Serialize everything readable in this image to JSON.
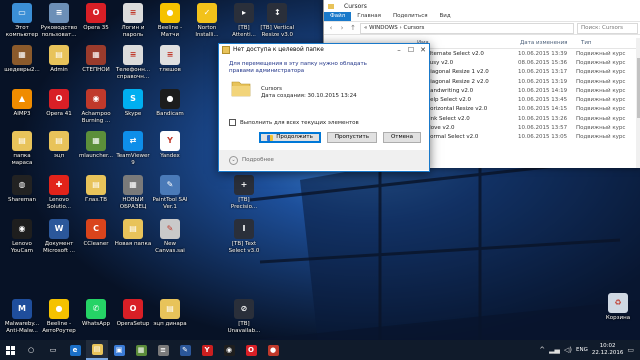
{
  "desktop": {
    "icons": [
      {
        "label": "Этот\nкомпьютер",
        "icon": "computer-icon",
        "color": "#3b8fd6",
        "glyph": "▭"
      },
      {
        "label": "Руководство\nпользоват...",
        "icon": "document-icon",
        "color": "#6c8fb7",
        "glyph": "≡"
      },
      {
        "label": "Opera 35",
        "icon": "opera-icon",
        "color": "#d81f26",
        "glyph": "O"
      },
      {
        "label": "Логин и\nпароль",
        "icon": "text-file-icon",
        "color": "#dcdcdc",
        "glyph": "≡"
      },
      {
        "label": "Beeline -\nМатчи",
        "icon": "beeline-icon",
        "color": "#f5c200",
        "glyph": "●"
      },
      {
        "label": "Norton\nInstalli...",
        "icon": "norton-icon",
        "color": "#f2c21a",
        "glyph": "✓"
      },
      {
        "label": "[TB]\nAttenti...",
        "icon": "cursor-icon",
        "color": "#2a2f3a",
        "glyph": "▸"
      },
      {
        "label": "[TB] Vertical\nResize v3.0",
        "icon": "cursor-icon",
        "color": "#2a2f3a",
        "glyph": "↕"
      },
      {
        "label": "шедевры2...",
        "icon": "image-icon",
        "color": "#8b5a2b",
        "glyph": "▦"
      },
      {
        "label": "Admin",
        "icon": "user-folder-icon",
        "color": "#e8c35a",
        "glyph": "▤"
      },
      {
        "label": "СТЕПНОЙ",
        "icon": "image-icon",
        "color": "#9a3b2c",
        "glyph": "▦"
      },
      {
        "label": "Телефонн...\nсправочн...",
        "icon": "document-icon",
        "color": "#dcdcdc",
        "glyph": "≡"
      },
      {
        "label": "тлешов",
        "icon": "document-icon",
        "color": "#e0e0e0",
        "glyph": "≡"
      },
      {
        "label": "[TB]\nAlternat...",
        "icon": "cursor-icon",
        "color": "#2a2f3a",
        "glyph": "▸"
      },
      {
        "label": "AIMP3",
        "icon": "aimp-icon",
        "color": "#f08c00",
        "glyph": "▲"
      },
      {
        "label": "Opera 41",
        "icon": "opera-icon",
        "color": "#d81f26",
        "glyph": "O"
      },
      {
        "label": "Achampoo\nBurning ...",
        "icon": "burning-icon",
        "color": "#c0392b",
        "glyph": "◉"
      },
      {
        "label": "Skype",
        "icon": "skype-icon",
        "color": "#00aff0",
        "glyph": "S"
      },
      {
        "label": "Bandicam",
        "icon": "bandicam-icon",
        "color": "#1c1c1c",
        "glyph": "●"
      },
      {
        "label": "[TB] Busy\nv3.0",
        "icon": "cursor-icon",
        "color": "#2a2f3a",
        "glyph": "◌"
      },
      {
        "label": "папка\nмараса",
        "icon": "folder-icon",
        "color": "#e8c35a",
        "glyph": "▤"
      },
      {
        "label": "эцп",
        "icon": "folder-icon",
        "color": "#e8c35a",
        "glyph": "▤"
      },
      {
        "label": "mlauncher...",
        "icon": "minecraft-icon",
        "color": "#5c8f3a",
        "glyph": "▦"
      },
      {
        "label": "TeamViewer\n9",
        "icon": "teamviewer-icon",
        "color": "#0e8ee9",
        "glyph": "⇄"
      },
      {
        "label": "Yandex",
        "icon": "yandex-icon",
        "color": "#ffffff",
        "glyph": "Y"
      },
      {
        "label": "[TB] Normal\nSelect v3.0",
        "icon": "cursor-icon",
        "color": "#2a2f3a",
        "glyph": "▸"
      },
      {
        "label": "Shareman",
        "icon": "shareman-icon",
        "color": "#222222",
        "glyph": "◍"
      },
      {
        "label": "Lenovo\nSolutio...",
        "icon": "lenovo-icon",
        "color": "#e2231a",
        "glyph": "✚"
      },
      {
        "label": "Глаз.TB",
        "icon": "folder-icon",
        "color": "#e8c35a",
        "glyph": "▤"
      },
      {
        "label": "НОВЫЙ\nОБРАЗЕЦ",
        "icon": "image-icon",
        "color": "#7a7a7a",
        "glyph": "▦"
      },
      {
        "label": "PaintTool SAI\nVer.1",
        "icon": "painttool-icon",
        "color": "#4a7ab8",
        "glyph": "✎"
      },
      {
        "label": "[TB]\nPrecisio...",
        "icon": "cursor-icon",
        "color": "#2a2f3a",
        "glyph": "+"
      },
      {
        "label": "Lenovo\nYouCam",
        "icon": "youcam-icon",
        "color": "#1e1e1e",
        "glyph": "◉"
      },
      {
        "label": "Документ\nMicrosoft ...",
        "icon": "word-icon",
        "color": "#2b579a",
        "glyph": "W"
      },
      {
        "label": "CCleaner",
        "icon": "ccleaner-icon",
        "color": "#d9441c",
        "glyph": "C"
      },
      {
        "label": "Новая папка",
        "icon": "folder-icon",
        "color": "#e8c35a",
        "glyph": "▤"
      },
      {
        "label": "New\nCanvas.sai",
        "icon": "sai-file-icon",
        "color": "#c9c9c9",
        "glyph": "✎"
      },
      {
        "label": "[TB] Text\nSelect v3.0",
        "icon": "cursor-icon",
        "color": "#2a2f3a",
        "glyph": "I"
      },
      {
        "label": "Malwareby...\nAnti-Malw...",
        "icon": "malwarebytes-icon",
        "color": "#1f4e9c",
        "glyph": "M"
      },
      {
        "label": "Beeline -\nАвтоРоутер",
        "icon": "beeline-icon",
        "color": "#f5c200",
        "glyph": "●"
      },
      {
        "label": "WhatsApp",
        "icon": "whatsapp-icon",
        "color": "#25d366",
        "glyph": "✆"
      },
      {
        "label": "OperaSetup",
        "icon": "opera-icon",
        "color": "#d81f26",
        "glyph": "O"
      },
      {
        "label": "эцп динара",
        "icon": "folder-icon",
        "color": "#e8c35a",
        "glyph": "▤"
      },
      {
        "label": "[TB]\nUnavailab...",
        "icon": "cursor-icon",
        "color": "#2a2f3a",
        "glyph": "⊘"
      },
      {
        "label": "Корзина",
        "icon": "recycle-bin-icon",
        "color": "#cfd8e3",
        "glyph": "♻"
      }
    ]
  },
  "explorer": {
    "title": "Cursors",
    "ribbon_tabs": [
      "Файл",
      "Главная",
      "Поделиться",
      "Вид"
    ],
    "address": "«  WINDOWS  ›  Cursors",
    "search_placeholder": "Поиск: Cursors",
    "columns": [
      "Имя",
      "Дата изменения",
      "Тип"
    ],
    "files": [
      {
        "name": "Alternate Select v2.0",
        "date": "10.06.2015 13:39",
        "type": "Подвижный курс"
      },
      {
        "name": "Busy v2.0",
        "date": "08.06.2015 15:36",
        "type": "Подвижный курс"
      },
      {
        "name": "Diagonal Resize 1 v2.0",
        "date": "10.06.2015 13:17",
        "type": "Подвижный курс"
      },
      {
        "name": "Diagonal Resize 2 v2.0",
        "date": "10.06.2015 13:19",
        "type": "Подвижный курс"
      },
      {
        "name": "Handwriting v2.0",
        "date": "10.06.2015 14:19",
        "type": "Подвижный курс"
      },
      {
        "name": "Help Select v2.0",
        "date": "10.06.2015 13:45",
        "type": "Подвижный курс"
      },
      {
        "name": "Horizontal Resize v2.0",
        "date": "10.06.2015 14:15",
        "type": "Подвижный курс"
      },
      {
        "name": "Link Select v2.0",
        "date": "10.06.2015 13:26",
        "type": "Подвижный курс"
      },
      {
        "name": "Move v2.0",
        "date": "10.06.2015 13:57",
        "type": "Подвижный курс"
      },
      {
        "name": "Normal Select v2.0",
        "date": "10.06.2015 13:05",
        "type": "Подвижный курс"
      }
    ]
  },
  "dialog": {
    "title": "Нет доступа к целевой папке",
    "message": "Для перемещения в эту папку нужно обладать правами администратора",
    "folder_name": "Cursors",
    "folder_date": "Дата создания: 30.10.2015 13:24",
    "checkbox_label": "Выполнить для всех текущих элементов",
    "buttons": {
      "continue": "Продолжить",
      "skip": "Пропустить",
      "cancel": "Отмена"
    },
    "details": "Подробнее"
  },
  "taskbar": {
    "items": [
      {
        "icon": "search-icon",
        "glyph": "○",
        "color": "transparent"
      },
      {
        "icon": "task-view-icon",
        "glyph": "▭",
        "color": "transparent"
      },
      {
        "icon": "edge-icon",
        "glyph": "e",
        "color": "#1b6fc6"
      },
      {
        "icon": "file-explorer-icon",
        "glyph": "▤",
        "color": "#e8c35a"
      },
      {
        "icon": "store-icon",
        "glyph": "▣",
        "color": "#3a7bd5"
      },
      {
        "icon": "image-app-icon",
        "glyph": "▦",
        "color": "#5b8c3a"
      },
      {
        "icon": "document-app-icon",
        "glyph": "≡",
        "color": "#7a7a7a"
      },
      {
        "icon": "pen-app-icon",
        "glyph": "✎",
        "color": "#2b579a"
      },
      {
        "icon": "yandex-browser-icon",
        "glyph": "Y",
        "color": "#cc1f1f"
      },
      {
        "icon": "camera-app-icon",
        "glyph": "◉",
        "color": "#1e1e1e"
      },
      {
        "icon": "opera-taskbar-icon",
        "glyph": "O",
        "color": "#d81f26"
      },
      {
        "icon": "record-app-icon",
        "glyph": "●",
        "color": "#c0392b"
      }
    ],
    "language": "ENG",
    "time": "10:02",
    "date": "22.12.2016"
  }
}
